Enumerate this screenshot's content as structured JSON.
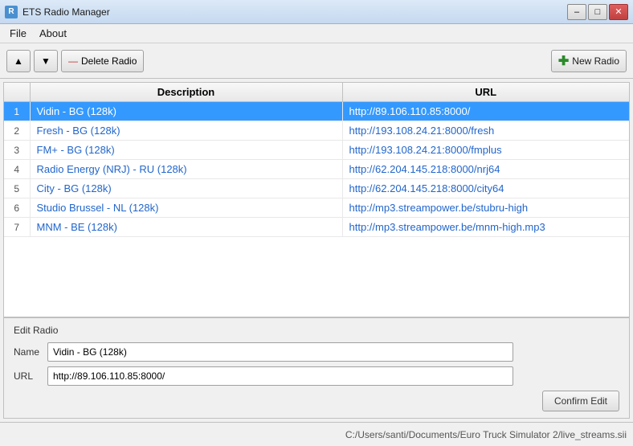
{
  "titleBar": {
    "icon": "R",
    "title": "ETS Radio Manager",
    "minimize": "–",
    "maximize": "□",
    "close": "✕"
  },
  "menuBar": {
    "items": [
      {
        "label": "File"
      },
      {
        "label": "About"
      }
    ]
  },
  "toolbar": {
    "upLabel": "▲",
    "downLabel": "▼",
    "deleteLabel": "Delete Radio",
    "newRadioLabel": "New Radio"
  },
  "table": {
    "columns": [
      "",
      "Description",
      "URL"
    ],
    "rows": [
      {
        "num": "1",
        "desc": "Vidin - BG (128k)",
        "url": "http://89.106.110.85:8000/",
        "selected": true
      },
      {
        "num": "2",
        "desc": "Fresh - BG (128k)",
        "url": "http://193.108.24.21:8000/fresh",
        "selected": false
      },
      {
        "num": "3",
        "desc": "FM+ - BG (128k)",
        "url": "http://193.108.24.21:8000/fmplus",
        "selected": false
      },
      {
        "num": "4",
        "desc": "Radio Energy (NRJ) - RU (128k)",
        "url": "http://62.204.145.218:8000/nrj64",
        "selected": false
      },
      {
        "num": "5",
        "desc": "City - BG (128k)",
        "url": "http://62.204.145.218:8000/city64",
        "selected": false
      },
      {
        "num": "6",
        "desc": "Studio Brussel - NL (128k)",
        "url": "http://mp3.streampower.be/stubru-high",
        "selected": false
      },
      {
        "num": "7",
        "desc": "MNM - BE (128k)",
        "url": "http://mp3.streampower.be/mnm-high.mp3",
        "selected": false
      }
    ]
  },
  "editPanel": {
    "title": "Edit Radio",
    "nameLabel": "Name",
    "urlLabel": "URL",
    "nameValue": "Vidin - BG (128k)",
    "urlValue": "http://89.106.110.85:8000/",
    "confirmLabel": "Confirm Edit"
  },
  "statusBar": {
    "path": "C:/Users/santi/Documents/Euro Truck Simulator 2/live_streams.sii"
  }
}
